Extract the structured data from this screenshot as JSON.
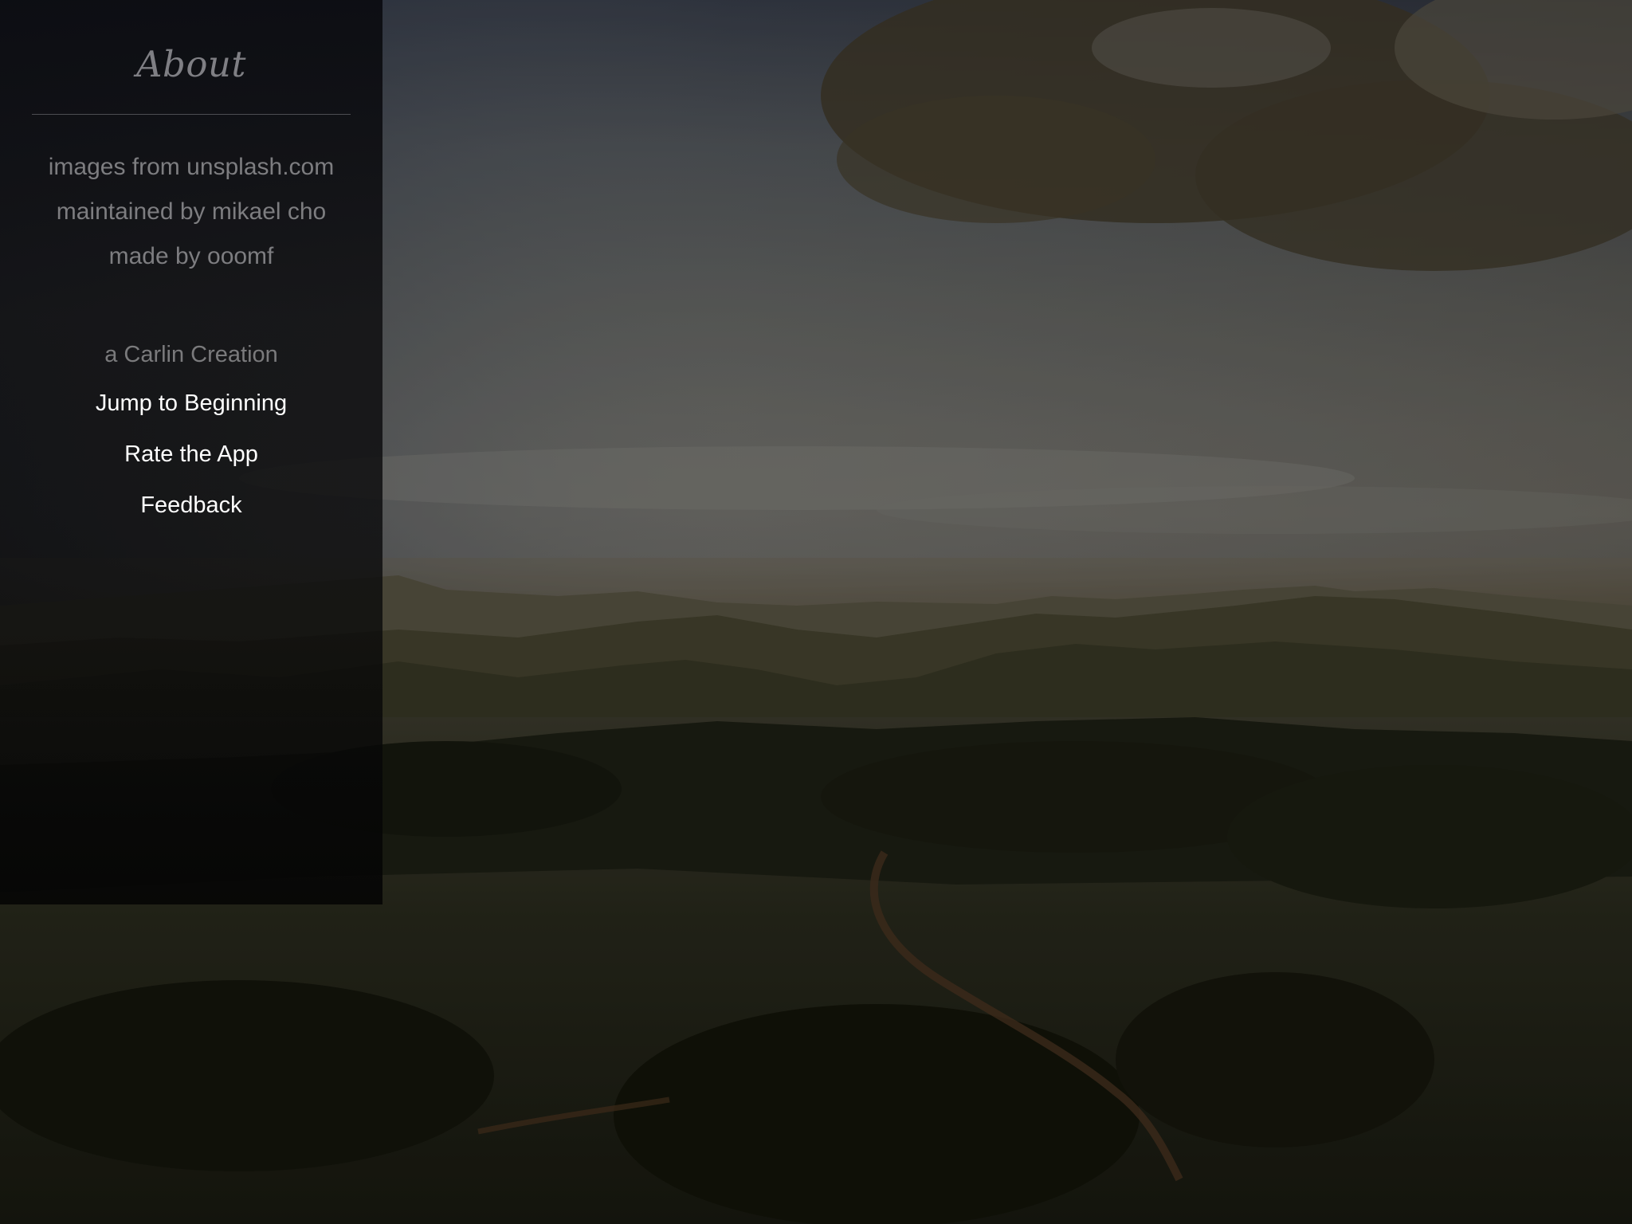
{
  "about_panel": {
    "title": "About",
    "credits": [
      "images from unsplash.com",
      "maintained by mikael cho",
      "made by ooomf"
    ],
    "tagline": "a Carlin Creation",
    "links": {
      "jump_to_beginning": "Jump to Beginning",
      "rate_the_app": "Rate the App",
      "feedback": "Feedback"
    }
  },
  "colors": {
    "panel_background": "#0e0f12",
    "title_text": "#7f7f84",
    "muted_text": "#7d7d80",
    "link_text": "#ffffff"
  }
}
